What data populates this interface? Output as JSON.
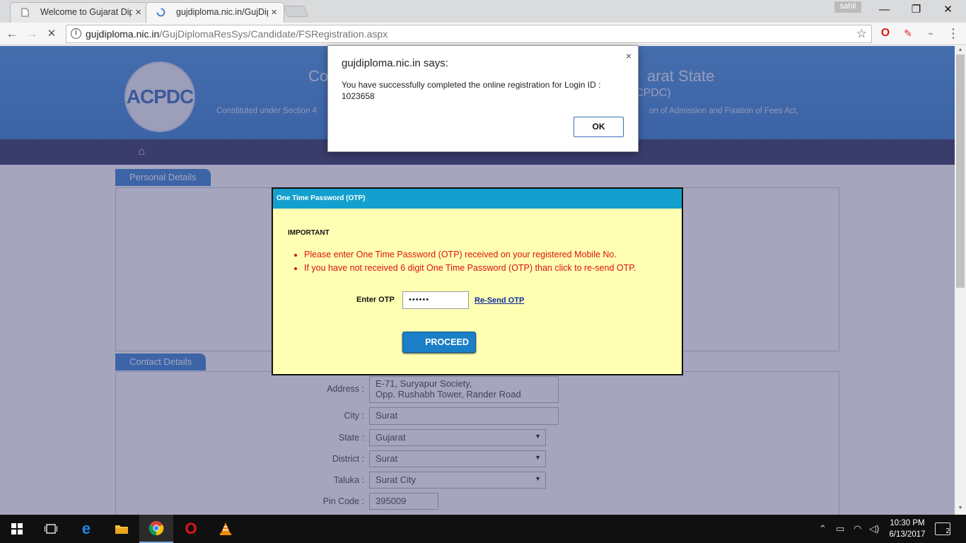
{
  "browser": {
    "tabs": [
      {
        "title": "Welcome to Gujarat Dipl",
        "close": "×"
      },
      {
        "title": "gujdiploma.nic.in/GujDip",
        "close": "×"
      }
    ],
    "profile_name": "sahil",
    "window_controls": {
      "minimize": "—",
      "maximize": "❐",
      "close": "✕"
    },
    "address": {
      "host": "gujdiploma.nic.in",
      "path": "/GujDiplomaResSys/Candidate/FSRegistration.aspx",
      "info": "i",
      "star": "☆"
    },
    "nav": {
      "back": "←",
      "forward": "→",
      "stop": "✕"
    },
    "extensions": [
      {
        "name": "opera-icon",
        "glyph": "O",
        "color": "#d61a1a"
      },
      {
        "name": "pen-extension-icon",
        "glyph": "✎",
        "color": "#e23"
      },
      {
        "name": "pdf-extension-icon",
        "glyph": "⌁",
        "color": "#999"
      },
      {
        "name": "menu-icon",
        "glyph": "⋮",
        "color": "#555"
      }
    ]
  },
  "site": {
    "logo_text": "ACPDC",
    "title_left": "Co",
    "title_right": "arat State",
    "subtitle_right": "CPDC)",
    "line_left": "Constituted under Section 4",
    "line_right": "on of Admission and Fixation of Fees Act,",
    "home_glyph": "⌂"
  },
  "sections": {
    "personal": "Personal Details",
    "contact": "Contact Details"
  },
  "contact_form": {
    "address_label": "Address :",
    "address_value_1": "E-71, Suryapur Society,",
    "address_value_2": "Opp. Rushabh Tower, Rander Road",
    "city_label": "City :",
    "city_value": "Surat",
    "state_label": "State :",
    "state_value": "Gujarat",
    "district_label": "District :",
    "district_value": "Surat",
    "taluka_label": "Taluka :",
    "taluka_value": "Surat City",
    "pincode_label": "Pin Code :",
    "pincode_value": "395009"
  },
  "otp_dialog": {
    "header": "One Time Password (OTP)",
    "important": "IMPORTANT",
    "bullets": [
      "Please enter One Time Password (OTP) received on your registered Mobile No.",
      "If you have not received 6 digit One Time Password (OTP) than click to re-send OTP."
    ],
    "label": "Enter OTP",
    "value": "••••••",
    "resend": "Re-Send OTP",
    "proceed": "PROCEED"
  },
  "alert": {
    "title": "gujdiploma.nic.in says:",
    "message_1": "You have successfully completed the online registration for Login ID :",
    "message_2": "1023658",
    "ok": "OK",
    "close": "×"
  },
  "taskbar": {
    "time": "10:30 PM",
    "date": "6/13/2017",
    "notification_count": "2"
  }
}
